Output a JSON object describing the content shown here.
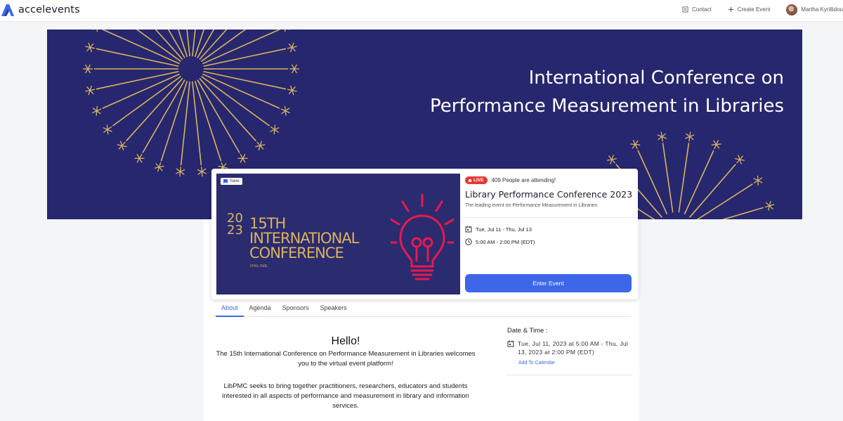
{
  "app": {
    "name": "accelevents"
  },
  "nav": {
    "contact": "Contact",
    "create_event": "Create Event",
    "user_name": "Martha Kyrillidou"
  },
  "banner": {
    "title_line1": "International Conference on",
    "title_line2": "Performance Measurement in Libraries"
  },
  "poster": {
    "save_label": "Save",
    "year_top": "20",
    "year_bottom": "23",
    "title_line1": "15TH",
    "title_line2": "INTERNATIONAL",
    "title_line3": "CONFERENCE",
    "subtitle": "ONLINE"
  },
  "event": {
    "live_badge": "LIVE",
    "attending": "409 People are attending!",
    "name": "Library Performance Conference 2023",
    "tagline": "The leading event on Performance Measurement in Libraries",
    "dates": "Tue, Jul 11 - Thu, Jul 13",
    "time": "5:00 AM - 2:00 PM (EDT)",
    "enter_label": "Enter Event"
  },
  "tabs": [
    {
      "label": "About",
      "active": true
    },
    {
      "label": "Agenda",
      "active": false
    },
    {
      "label": "Sponsors",
      "active": false
    },
    {
      "label": "Speakers",
      "active": false
    }
  ],
  "about": {
    "heading": "Hello!",
    "welcome": "The 15th International Conference on Performance Measurement in Libraries welcomes you to the virtual event platform!",
    "paragraph": "LibPMC seeks to bring together practitioners, researchers, educators and students interested in all aspects of performance and measurement in library and information services."
  },
  "datetime": {
    "heading": "Date & Time :",
    "range": "Tue, Jul 11, 2023 at 5:00 AM - Thu, Jul 13, 2023 at 2:00 PM (EDT)",
    "add_to_calendar": "Add To Calendar"
  },
  "colors": {
    "accent": "#3d67e8",
    "banner_bg": "#27276f",
    "gold": "#d9b35e",
    "live": "#e53935",
    "bulb": "#e8194e"
  }
}
